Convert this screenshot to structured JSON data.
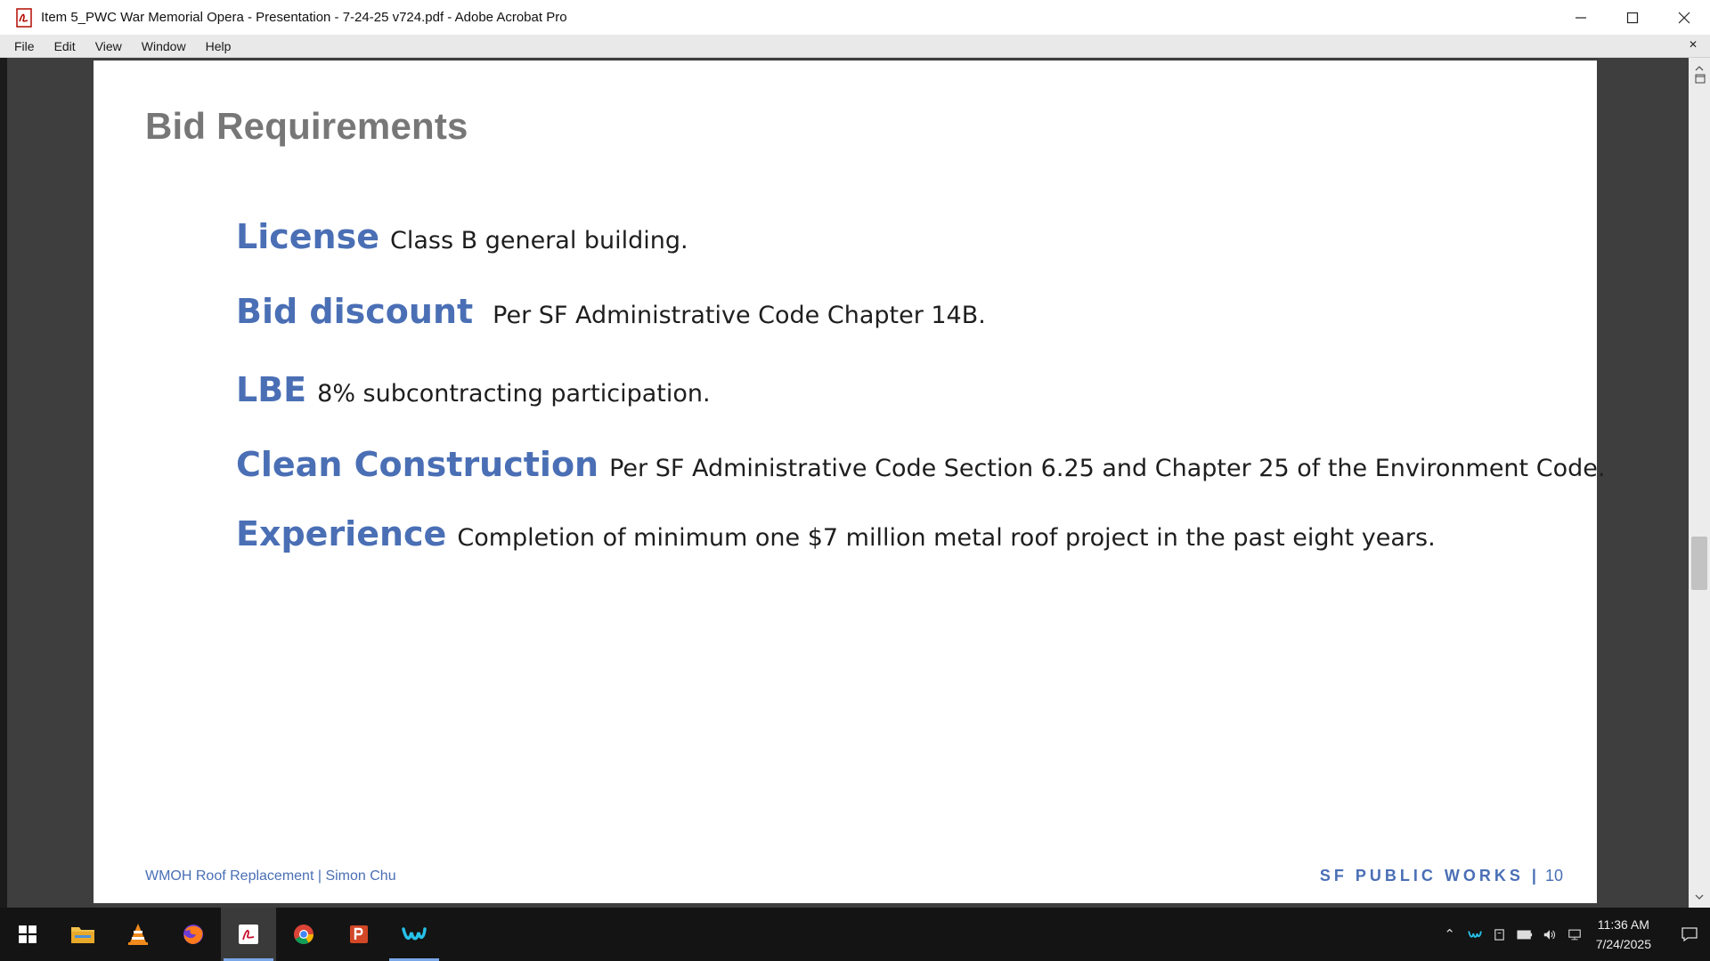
{
  "window": {
    "title": "Item 5_PWC War Memorial Opera - Presentation - 7-24-25 v724.pdf - Adobe Acrobat Pro"
  },
  "menu": [
    "File",
    "Edit",
    "View",
    "Window",
    "Help"
  ],
  "slide": {
    "title": "Bid Requirements",
    "items": [
      {
        "term": "License",
        "desc": "Class B general building."
      },
      {
        "term": "Bid discount",
        "desc": "Per SF Administrative Code Chapter 14B."
      },
      {
        "term": "LBE",
        "desc": "8% subcontracting participation."
      },
      {
        "term": "Clean Construction",
        "desc": "Per SF Administrative Code Section 6.25 and Chapter 25 of the Environment Code."
      },
      {
        "term": "Experience",
        "desc": "Completion of minimum one $7 million metal roof project in the past eight years."
      }
    ],
    "footer_left": "WMOH Roof Replacement | Simon Chu",
    "footer_right": "SF PUBLIC WORKS |",
    "page_number": "10"
  },
  "colors": {
    "accent": "#4a6fb5",
    "title_gray": "#777777"
  },
  "taskbar": {
    "apps": [
      "windows-start",
      "file-explorer",
      "vlc",
      "firefox",
      "adobe-acrobat",
      "chrome",
      "powerpoint",
      "webex"
    ],
    "active_app": "adobe-acrobat",
    "time": "11:36 AM",
    "date": "7/24/2025"
  }
}
